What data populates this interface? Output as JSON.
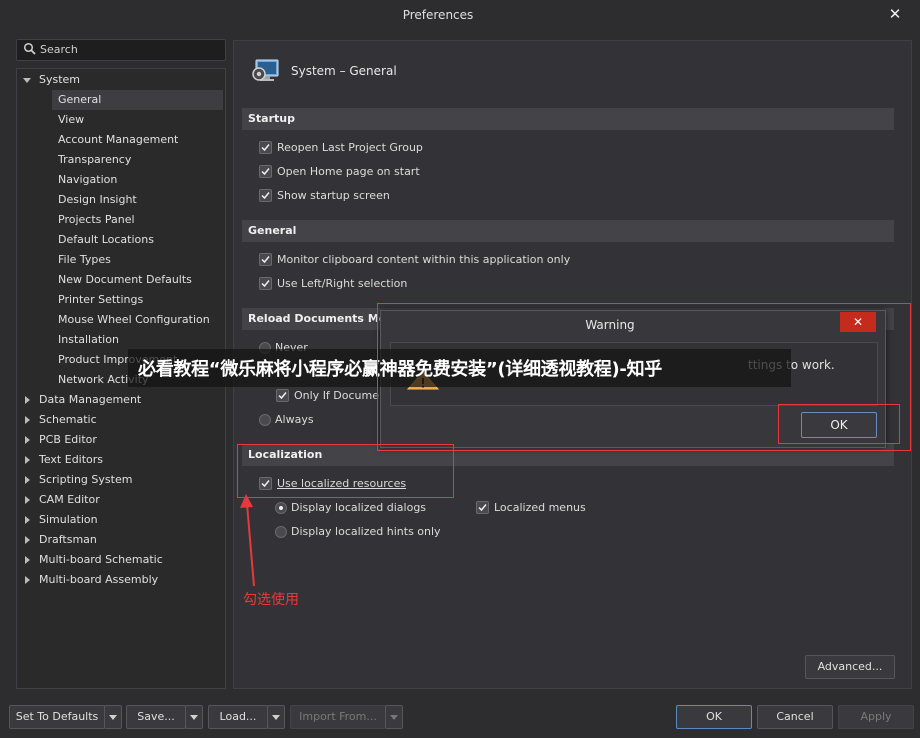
{
  "window": {
    "title": "Preferences"
  },
  "search": {
    "placeholder": "Search"
  },
  "tree": {
    "system": "System",
    "system_children": [
      "General",
      "View",
      "Account Management",
      "Transparency",
      "Navigation",
      "Design Insight",
      "Projects Panel",
      "Default Locations",
      "File Types",
      "New Document Defaults",
      "Printer Settings",
      "Mouse Wheel Configuration",
      "Installation",
      "Product Improvement",
      "Network Activity"
    ],
    "categories": [
      "Data Management",
      "Schematic",
      "PCB Editor",
      "Text Editors",
      "Scripting System",
      "CAM Editor",
      "Simulation",
      "Draftsman",
      "Multi-board Schematic",
      "Multi-board Assembly"
    ],
    "selected": "General"
  },
  "panel": {
    "title": "System – General",
    "startup": {
      "header": "Startup",
      "items": [
        {
          "label": "Reopen Last Project Group",
          "checked": true
        },
        {
          "label": "Open Home page on start",
          "checked": true
        },
        {
          "label": "Show startup screen",
          "checked": true
        }
      ]
    },
    "general": {
      "header": "General",
      "items": [
        {
          "label": "Monitor clipboard content within this application only",
          "checked": true
        },
        {
          "label": "Use Left/Right selection",
          "checked": true
        }
      ]
    },
    "reload": {
      "header": "Reload Documents Modif",
      "never": "Never",
      "only_if": "Only If Document",
      "always": "Always"
    },
    "localization": {
      "header": "Localization",
      "use_localized": "Use localized resources",
      "display_dialogs": "Display localized dialogs",
      "display_hints": "Display localized hints only",
      "localized_menus": "Localized menus"
    },
    "advanced": "Advanced..."
  },
  "bottom": {
    "set_defaults": "Set To Defaults",
    "save": "Save...",
    "load": "Load...",
    "import_from": "Import From...",
    "ok": "OK",
    "cancel": "Cancel",
    "apply": "Apply"
  },
  "warning": {
    "title": "Warning",
    "message": "ttings to work.",
    "ok": "OK"
  },
  "watermark": "必看教程“微乐麻将小程序必赢神器免费安装”(详细透视教程)-知乎",
  "annotation": "勾选使用",
  "colors": {
    "accent_red": "#e8383a",
    "close_red": "#c42b1c",
    "bg": "#2d2d30"
  }
}
